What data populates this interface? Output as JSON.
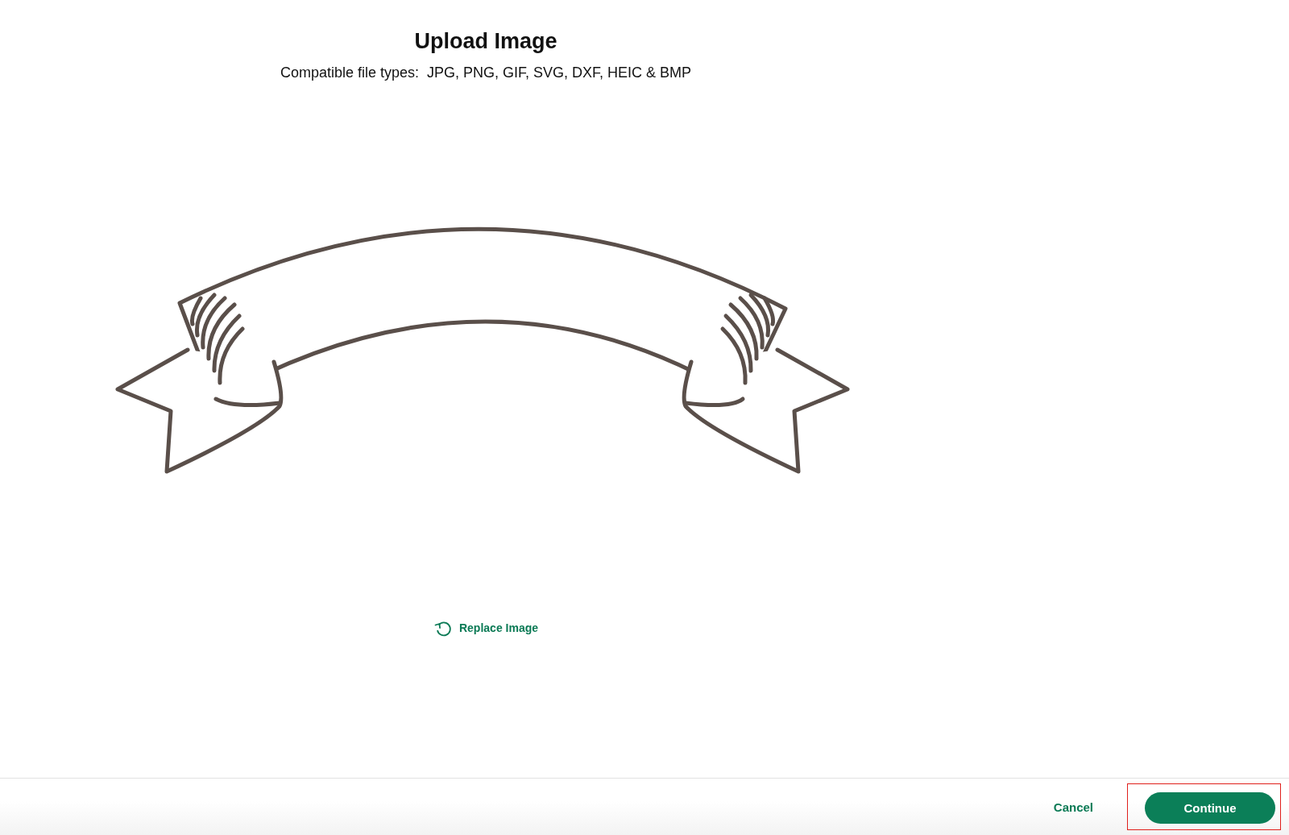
{
  "dialog": {
    "title": "Upload Image",
    "subtitle": "Compatible file types:  JPG, PNG, GIF, SVG, DXF, HEIC & BMP"
  },
  "preview": {
    "kind": "ribbon"
  },
  "replace_link": {
    "label": "Replace Image"
  },
  "footer": {
    "buttons": [
      {
        "label": "Cancel",
        "kind": "link",
        "highlighted": false
      },
      {
        "label": "Continue",
        "kind": "primary",
        "highlighted": true
      }
    ]
  }
}
